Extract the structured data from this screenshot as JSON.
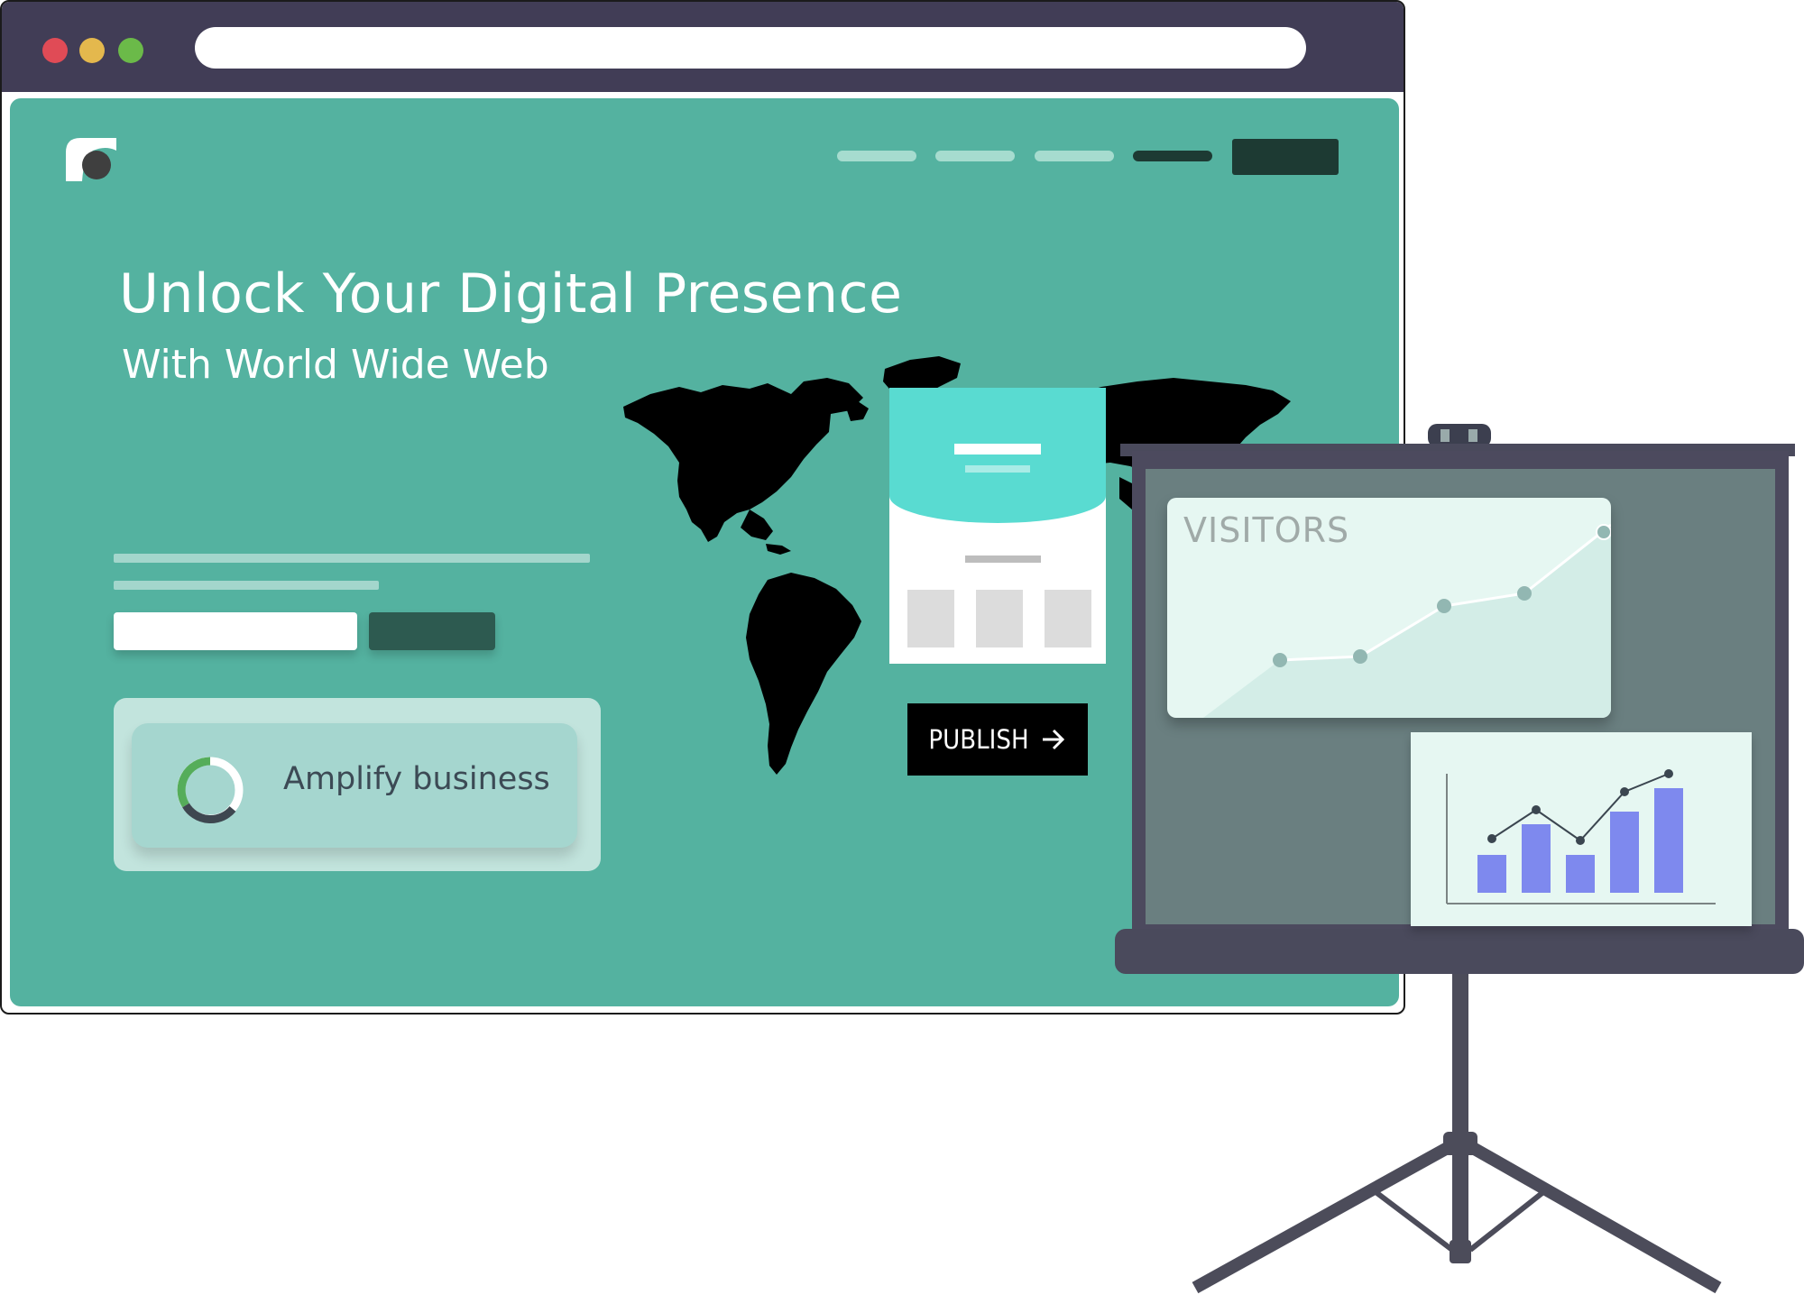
{
  "window": {
    "traffic_lights": [
      "#e04b56",
      "#e4b84d",
      "#6bba49"
    ],
    "titlebar_color": "#413d56",
    "page_color": "#54b2a0"
  },
  "hero": {
    "title": "Unlock Your Digital Presence",
    "subtitle": "With World Wide Web"
  },
  "feature_card": {
    "label": "Amplify business",
    "icon": "donut-progress-icon"
  },
  "publish": {
    "label": "PUBLISH",
    "icon": "arrow-right-icon"
  },
  "projector": {
    "visitors_label": "VISITORS",
    "bar_color": "#7e89ee"
  }
}
